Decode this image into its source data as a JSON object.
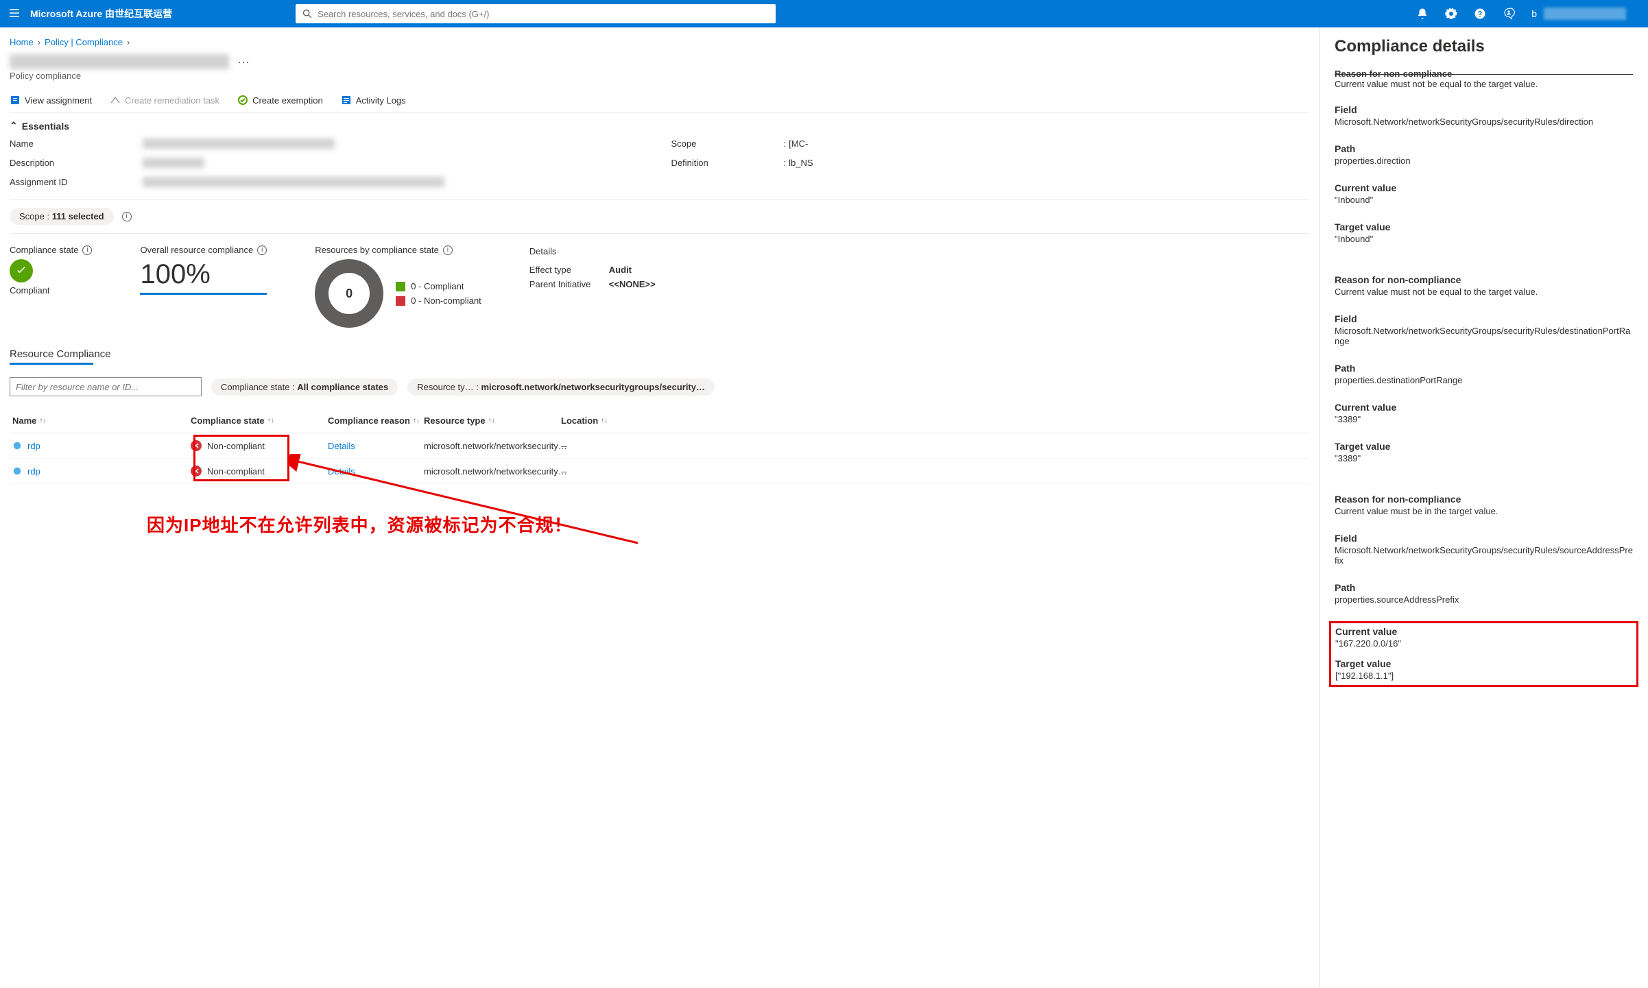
{
  "topbar": {
    "brand": "Microsoft Azure 由世纪互联运营",
    "search_placeholder": "Search resources, services, and docs (G+/)",
    "user_initial": "b"
  },
  "breadcrumb": {
    "home": "Home",
    "policy": "Policy | Compliance"
  },
  "page": {
    "subtitle": "Policy compliance",
    "more": "···"
  },
  "cmd": {
    "view_assignment": "View assignment",
    "create_remediation": "Create remediation task",
    "create_exemption": "Create exemption",
    "activity_logs": "Activity Logs"
  },
  "essentials": {
    "header": "Essentials",
    "name_label": "Name",
    "description_label": "Description",
    "assignment_id_label": "Assignment ID",
    "scope_label": "Scope",
    "scope_value_visible": "[MC-",
    "definition_label": "Definition",
    "definition_value_visible": "lb_NS"
  },
  "scope_pill": {
    "label": "Scope :",
    "value": "111 selected"
  },
  "stats": {
    "compliance_state_label": "Compliance state",
    "compliance_state_value": "Compliant",
    "overall_label": "Overall resource compliance",
    "overall_value": "100%",
    "bystate_label": "Resources by compliance state",
    "donut_center": "0",
    "legend": [
      {
        "color": "#57a300",
        "label": "0 - Compliant"
      },
      {
        "color": "#d13438",
        "label": "0 - Non-compliant"
      }
    ],
    "details_label": "Details",
    "details_effect_type_label": "Effect type",
    "details_effect_type_value": "Audit",
    "details_parent_label": "Parent Initiative",
    "details_parent_value": "<<NONE>>"
  },
  "resource_compliance": {
    "heading": "Resource Compliance",
    "filter_placeholder": "Filter by resource name or ID...",
    "pill_compliance_state_label": "Compliance state :",
    "pill_compliance_state_value": "All compliance states",
    "pill_resource_type_label": "Resource ty… :",
    "pill_resource_type_value": "microsoft.network/networksecuritygroups/security…",
    "columns": {
      "name": "Name",
      "state": "Compliance state",
      "reason": "Compliance reason",
      "type": "Resource type",
      "location": "Location"
    },
    "rows": [
      {
        "name": "rdp",
        "state": "Non-compliant",
        "reason_link": "Details",
        "type": "microsoft.network/networksecurity…",
        "location": "--"
      },
      {
        "name": "rdp",
        "state": "Non-compliant",
        "reason_link": "Details",
        "type": "microsoft.network/networksecurity…",
        "location": "--"
      }
    ]
  },
  "annotation": {
    "text": "因为IP地址不在允许列表中，资源被标记为不合规！"
  },
  "side_panel": {
    "title": "Compliance details",
    "top_cut": {
      "reason_strike": "Reason for non-compliance",
      "reason_body": "Current value must not be equal to the target value."
    },
    "groups": [
      {
        "field_h": "Field",
        "field_v": "Microsoft.Network/networkSecurityGroups/securityRules/direction",
        "path_h": "Path",
        "path_v": "properties.direction",
        "current_h": "Current value",
        "current_v": "\"Inbound\"",
        "target_h": "Target value",
        "target_v": "\"Inbound\""
      },
      {
        "reason_h": "Reason for non-compliance",
        "reason_v": "Current value must not be equal to the target value.",
        "field_h": "Field",
        "field_v": "Microsoft.Network/networkSecurityGroups/securityRules/destinationPortRange",
        "path_h": "Path",
        "path_v": "properties.destinationPortRange",
        "current_h": "Current value",
        "current_v": "\"3389\"",
        "target_h": "Target value",
        "target_v": "\"3389\""
      },
      {
        "reason_h": "Reason for non-compliance",
        "reason_v": "Current value must be in the target value.",
        "field_h": "Field",
        "field_v": "Microsoft.Network/networkSecurityGroups/securityRules/sourceAddressPrefix",
        "path_h": "Path",
        "path_v": "properties.sourceAddressPrefix",
        "current_h": "Current value",
        "current_v": "\"167.220.0.0/16\"",
        "target_h": "Target value",
        "target_v": "[\"192.168.1.1\"]"
      }
    ]
  }
}
